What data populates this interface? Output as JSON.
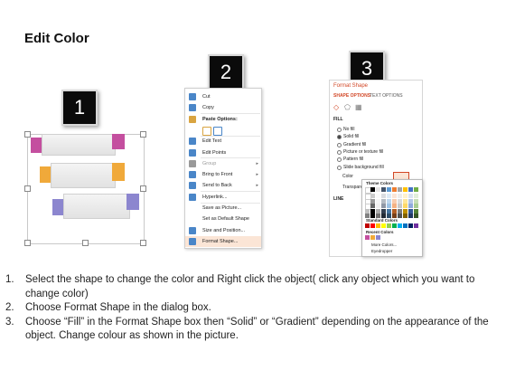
{
  "title": "Edit Color",
  "steps": [
    {
      "badge": "1"
    },
    {
      "badge": "2"
    },
    {
      "badge": "3"
    }
  ],
  "ribbons": [
    {
      "color": "#c44f9f"
    },
    {
      "color": "#f0a93a"
    },
    {
      "color": "#8c86cf"
    }
  ],
  "context_menu": {
    "items": [
      {
        "label": "Cut",
        "icon": "scissors-icon",
        "underline": 0
      },
      {
        "label": "Copy",
        "icon": "copy-icon",
        "underline": 0
      },
      {
        "label": "Paste Options:",
        "icon": "paste-icon",
        "bold": true
      },
      {
        "label": "",
        "icon": "paste-option-icons"
      },
      {
        "label": "Edit Text",
        "icon": "edit-text-icon"
      },
      {
        "label": "Edit Points",
        "icon": "edit-points-icon"
      },
      {
        "label": "Group",
        "icon": "group-icon",
        "arrow": "▸",
        "disabled": true
      },
      {
        "label": "Bring to Front",
        "icon": "bring-front-icon",
        "arrow": "▸"
      },
      {
        "label": "Send to Back",
        "icon": "send-back-icon",
        "arrow": "▸"
      },
      {
        "label": "Hyperlink...",
        "icon": "hyperlink-icon"
      },
      {
        "label": "Save as Picture...",
        "icon": ""
      },
      {
        "label": "Set as Default Shape",
        "icon": ""
      },
      {
        "label": "Size and Position...",
        "icon": "size-position-icon"
      },
      {
        "label": "Format Shape...",
        "icon": "format-shape-icon",
        "highlight": true
      }
    ]
  },
  "format_pane": {
    "title": "Format Shape",
    "tabs": [
      "SHAPE OPTIONS",
      "TEXT OPTIONS"
    ],
    "section_fill": "FILL",
    "fill_options": [
      "No fill",
      "Solid fill",
      "Gradient fill",
      "Picture or texture fill",
      "Pattern fill",
      "Slide background fill"
    ],
    "selected_fill": 1,
    "color_label": "Color",
    "transparency_label": "Transparency",
    "section_line": "LINE"
  },
  "color_palette": {
    "theme_colors_label": "Theme Colors",
    "standard_colors_label": "Standard Colors",
    "recent_colors_label": "Recent Colors",
    "more_colors": "More Colors...",
    "eyedropper": "Eyedropper",
    "theme_row": [
      "#ffffff",
      "#000000",
      "#e7e6e6",
      "#44546a",
      "#5b9bd5",
      "#ed7d31",
      "#a5a5a5",
      "#ffc000",
      "#4472c4",
      "#70ad47"
    ],
    "standard_row": [
      "#c00000",
      "#ff0000",
      "#ffc000",
      "#ffff00",
      "#92d050",
      "#00b050",
      "#00b0f0",
      "#0070c0",
      "#002060",
      "#7030a0"
    ],
    "recent_row": [
      "#c44f9f",
      "#f0a93a",
      "#8c86cf"
    ]
  },
  "instructions": [
    {
      "num": "1.",
      "text": "Select the shape to change the color and Right click the object( click any object which you want to change color)"
    },
    {
      "num": "2.",
      "text": "Choose Format Shape in the dialog box."
    },
    {
      "num": "3.",
      "text": "Choose “Fill” in the Format Shape box then “Solid” or “Gradient” depending on the appearance of the object. Change colour as shown in the picture."
    }
  ]
}
